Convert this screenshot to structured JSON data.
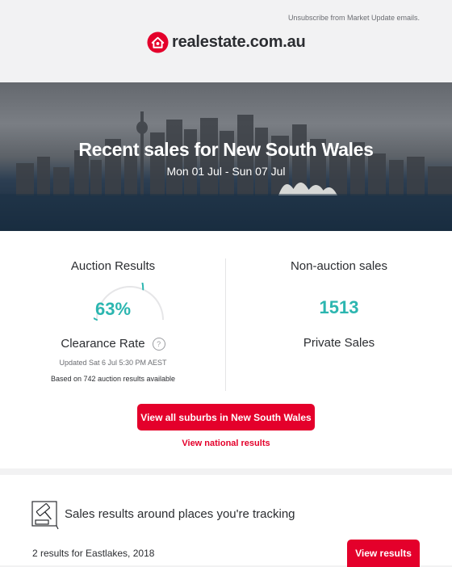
{
  "header": {
    "unsubscribe_text": "Unsubscribe from Market Update emails.",
    "logo_text": "realestate.com.au",
    "brand_color": "#e4002b"
  },
  "hero": {
    "title": "Recent sales for New South Wales",
    "date_range": "Mon 01 Jul - Sun 07 Jul"
  },
  "auction": {
    "title": "Auction Results",
    "clearance_percent": "63%",
    "clearance_value": 0.63,
    "clearance_label": "Clearance Rate",
    "help_icon": "?",
    "updated": "Updated Sat 6 Jul 5:30 PM AEST",
    "based_on": "Based on 742 auction results available",
    "accent_color": "#2cb6b0"
  },
  "non_auction": {
    "title": "Non-auction sales",
    "count": "1513",
    "label": "Private Sales"
  },
  "actions": {
    "view_all_label": "View all suburbs in New South Wales",
    "view_national_label": "View national results"
  },
  "tracking": {
    "icon": "gavel-icon",
    "title": "Sales results around places you're tracking",
    "result_text": "2 results for Eastlakes, 2018",
    "view_results_label": "View results"
  }
}
